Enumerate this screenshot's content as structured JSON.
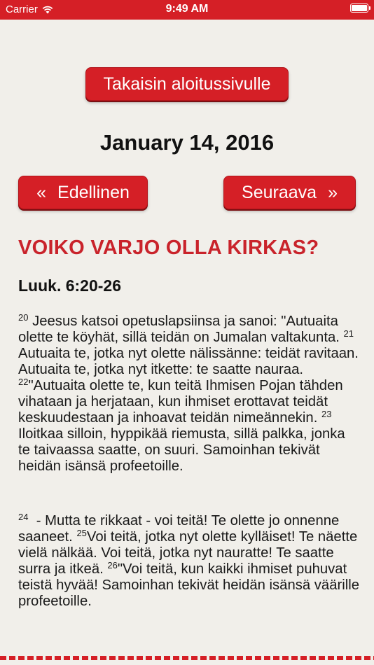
{
  "status_bar": {
    "carrier": "Carrier",
    "time": "9:49 AM"
  },
  "nav": {
    "home_label": "Takaisin aloitussivulle",
    "prev_label": "Edellinen",
    "prev_glyph": "«",
    "next_label": "Seuraava",
    "next_glyph": "»"
  },
  "date": "January 14, 2016",
  "devotion": {
    "title": "VOIKO VARJO OLLA KIRKAS?",
    "reference": "Luuk. 6:20-26",
    "verses": {
      "v20_num": "20",
      "v20_text": "Jeesus katsoi opetuslapsiinsa ja sanoi: \"Autuaita olette te köyhät, sillä teidän on Jumalan valtakunta.",
      "v21_num": "21",
      "v21_text": "Autuaita te, jotka nyt olette nälissänne: teidät ravitaan. Autuaita te, jotka nyt itkette: te saatte nauraa.",
      "v22_num": "22",
      "v22_text": "\"Autuaita olette te, kun teitä Ihmisen Pojan tähden vihataan ja herjataan, kun ihmiset erottavat teidät keskuudestaan ja inhoavat teidän nimeännekin.",
      "v23_num": "23",
      "v23_text": "Iloitkaa silloin, hyppikää riemusta, sillä palkka, jonka te taivaassa saatte, on suuri. Samoinhan tekivät heidän isänsä profeetoille.",
      "v24_num": "24",
      "v24_text": "- Mutta te rikkaat - voi teitä! Te olette jo onnenne saaneet.",
      "v25_num": "25",
      "v25_text": "Voi teitä, jotka nyt olette kylläiset! Te näette vielä nälkää. Voi teitä, jotka nyt nauratte! Te saatte surra ja itkeä.",
      "v26_num": "26",
      "v26_text": "\"Voi teitä, kun kaikki ihmiset puhuvat teistä hyvää! Samoinhan tekivät heidän isänsä väärille profeetoille."
    }
  },
  "colors": {
    "accent": "#d51f26",
    "title": "#c9232b",
    "background": "#f1efea"
  }
}
